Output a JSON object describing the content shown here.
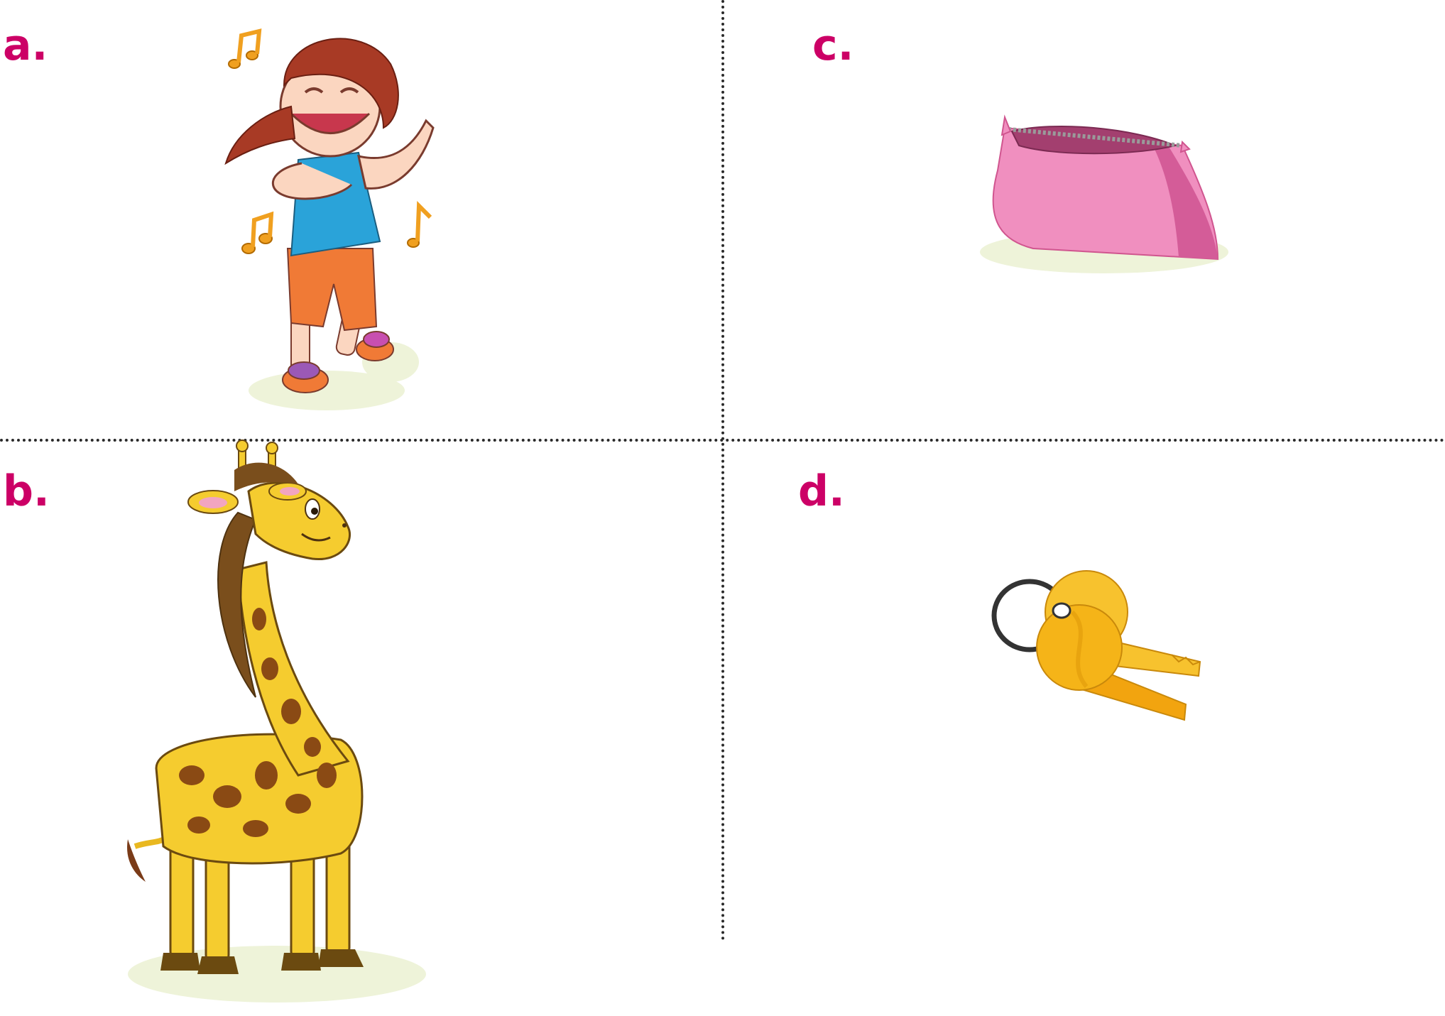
{
  "panels": [
    {
      "letter": "a.",
      "subject": "dancing-girl-illustration"
    },
    {
      "letter": "b.",
      "subject": "giraffe-illustration"
    },
    {
      "letter": "c.",
      "subject": "pencil-case-illustration"
    },
    {
      "letter": "d.",
      "subject": "keys-illustration"
    }
  ],
  "colors": {
    "letter": "#cc0066",
    "divider": "#2a2a2a",
    "shadow": "#eef3d9"
  }
}
